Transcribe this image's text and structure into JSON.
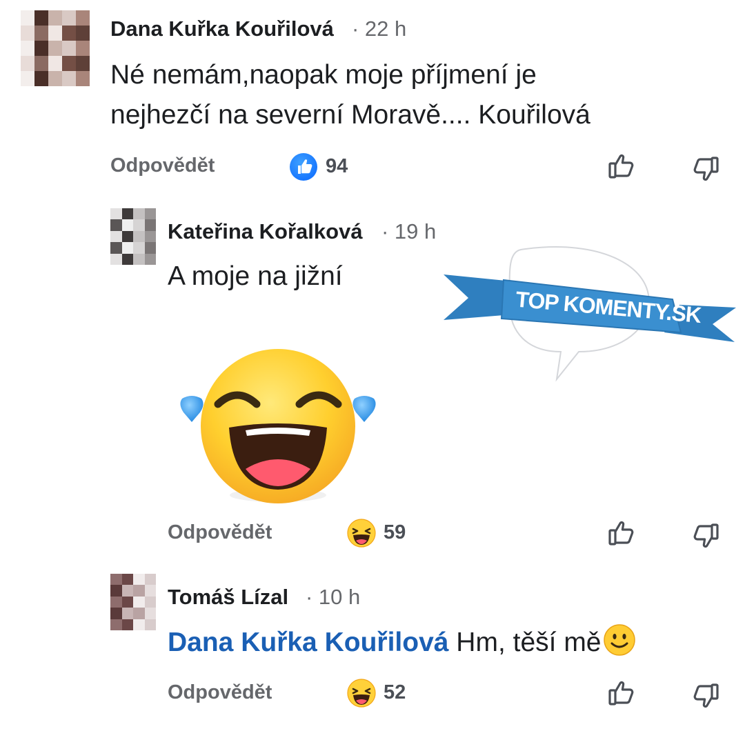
{
  "comments": [
    {
      "author": "Dana Kuřka Kouřilová",
      "time": "· 22 h",
      "lines": [
        "Né nemám,naopak moje příjmení je",
        "nejhezčí na severní Moravě.... Kouřilová"
      ],
      "reply_label": "Odpovědět",
      "reaction_icon": "like-icon",
      "reaction_count": "94"
    },
    {
      "author": "Kateřina Kořalková",
      "time": "· 19 h",
      "text": "A moje na jižní",
      "sticker": "laughing-tears-emoji",
      "reply_label": "Odpovědět",
      "reaction_icon": "haha-icon",
      "reaction_count": "59"
    },
    {
      "author": "Tomáš Lízal",
      "time": "· 10 h",
      "mention": "Dana Kuřka Kouřilová",
      "text": "Hm, těší mě",
      "trailing_emoji": "smiling-face-emoji",
      "reply_label": "Odpovědět",
      "reaction_icon": "haha-icon",
      "reaction_count": "52"
    }
  ],
  "watermark": {
    "text": "TOP KOMENTY.SK",
    "ribbon_color": "#3a8fd0",
    "bubble": "speech-bubble-outline"
  },
  "colors": {
    "name": "#1c1e21",
    "meta": "#65676b",
    "mention": "#1a5fb4",
    "like": "#0866ff"
  }
}
